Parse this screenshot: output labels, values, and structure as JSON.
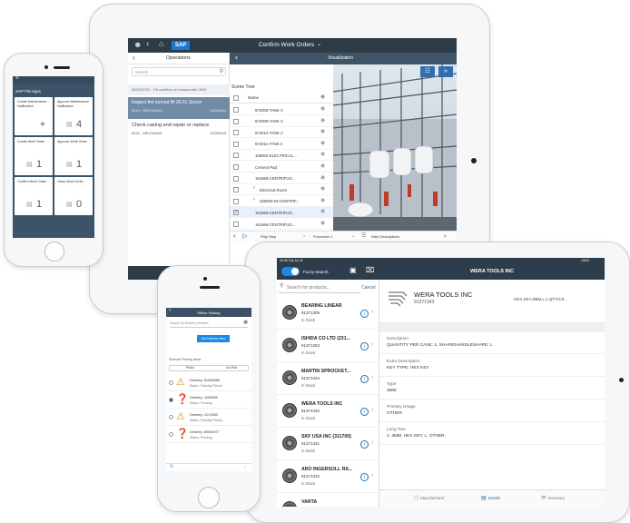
{
  "tablet_back": {
    "shell_title": "Confirm Work Orders",
    "logo": "SAP",
    "left_panel": {
      "title": "Operations",
      "search_placeholder": "Search",
      "header_item": "000022202 - Oil overflow on transponder 3000",
      "items": [
        {
          "title": "Inspect the turnout fill 36.01 Sector",
          "sub": "0010 - MECHANIC",
          "num": "10200044",
          "selected": true
        },
        {
          "title": "Check casing and repair or replace",
          "sub": "0020 - MECHANIK",
          "num": "10200045",
          "selected": false
        }
      ]
    },
    "right_panel": {
      "title": "Visualization",
      "scene_tree_label": "Scene Tree",
      "name_col": "Name",
      "rows": [
        {
          "label": "572009-TANK 2",
          "checked": false
        },
        {
          "label": "572009-TANK 2",
          "checked": false
        },
        {
          "label": "572010-TANK 2",
          "checked": false
        },
        {
          "label": "572011-TANK 2",
          "checked": false
        },
        {
          "label": "108002-ELECTRICAL...",
          "checked": false
        },
        {
          "label": "Cement Pad",
          "checked": false
        },
        {
          "label": "161968-CENTRIFUG...",
          "checked": false
        },
        {
          "label": "Electrical Room",
          "checked": false
        },
        {
          "label": "430000-03-CENTRIF...",
          "checked": false
        },
        {
          "label": "161968-CENTRIFUG...",
          "checked": true
        },
        {
          "label": "161968-CENTRIFUG...",
          "checked": false
        }
      ],
      "footer": {
        "play_step": "Play Step",
        "procedure": "Procedure 1",
        "step_desc": "Step Descriptions"
      }
    }
  },
  "phone_left": {
    "header_title": "SAP FM Apps",
    "tiles": [
      {
        "title": "Create Maintenance Notification",
        "value": "",
        "icon": "plus-icon"
      },
      {
        "title": "Approve Maintenance Notification",
        "value": "4",
        "icon": "doc-icon"
      },
      {
        "title": "Create Work Order",
        "value": "1",
        "icon": "doc-icon"
      },
      {
        "title": "Approve Work Order",
        "value": "1",
        "icon": "doc-icon"
      },
      {
        "title": "Confirm Work Order",
        "value": "1",
        "icon": "doc-icon"
      },
      {
        "title": "Close Work Order",
        "value": "0",
        "icon": "doc-icon"
      }
    ]
  },
  "phone_center": {
    "header_title": "Offline Picking",
    "search_placeholder": "Search by Delivery Number",
    "button_label": "Get Delivery Item",
    "section_label": "Selected Picking Items",
    "toggle": {
      "left": "Pickd",
      "right": "Un-Pkd"
    },
    "items": [
      {
        "title": "Delivery: 81009886",
        "status": "Status: Partially Picked",
        "icon": "warning-icon",
        "selected": false
      },
      {
        "title": "Delivery: 1230988",
        "status": "Status: Pending",
        "icon": "question-icon",
        "selected": true
      },
      {
        "title": "Delivery: 1217666",
        "status": "Status: Partially Picked",
        "icon": "warning-icon",
        "selected": false
      },
      {
        "title": "Delivery: 80000077",
        "status": "Status: Pending",
        "icon": "question-icon",
        "selected": false
      }
    ]
  },
  "tablet_front": {
    "status_time": "09:40 Tue Jul 31",
    "status_right": "100%",
    "fuzzy_label": "Fuzzy Search",
    "search_placeholder": "Search for products...",
    "cancel_label": "Cancel",
    "detail_header": "WERA TOOLS INC",
    "products": [
      {
        "name": "BEARING LINEAR",
        "num": "91371309",
        "stock": "In Stock"
      },
      {
        "name": "ISHIDA CO LTD (231...",
        "num": "91371253",
        "stock": "In Stock"
      },
      {
        "name": "MARTIN SPROCKET...",
        "num": "91371334",
        "stock": "In Stock"
      },
      {
        "name": "WERA TOOLS INC",
        "num": "91371340",
        "stock": "In Stock"
      },
      {
        "name": "SKF USA INC (311700)",
        "num": "91371341",
        "stock": "In Stock"
      },
      {
        "name": "ARO INGERSOLL RA...",
        "num": "91371342",
        "stock": "In Stock"
      },
      {
        "name": "VARTA",
        "num": "",
        "stock": ""
      }
    ],
    "detail": {
      "title": "WERA TOOLS INC",
      "num": "91371343",
      "side_text": "HEX KEY,3MM,L,1 QTY/CS",
      "fields": [
        {
          "label": "Description",
          "value": "QUANTITY PER CASE: 1, SHAPE/HANDLESHAPE: L"
        },
        {
          "label": "Extra Description",
          "value": "KEY TYPE: HEX KEY"
        },
        {
          "label": "Type",
          "value": "3MM"
        },
        {
          "label": "Primary Usage",
          "value": "OTHER"
        },
        {
          "label": "Long Text",
          "value": "1, 3MM, HEX KEY, L, OTHER"
        }
      ],
      "tabs": [
        "Manufacturer",
        "Details",
        "Inventory"
      ],
      "active_tab": "Details"
    }
  }
}
